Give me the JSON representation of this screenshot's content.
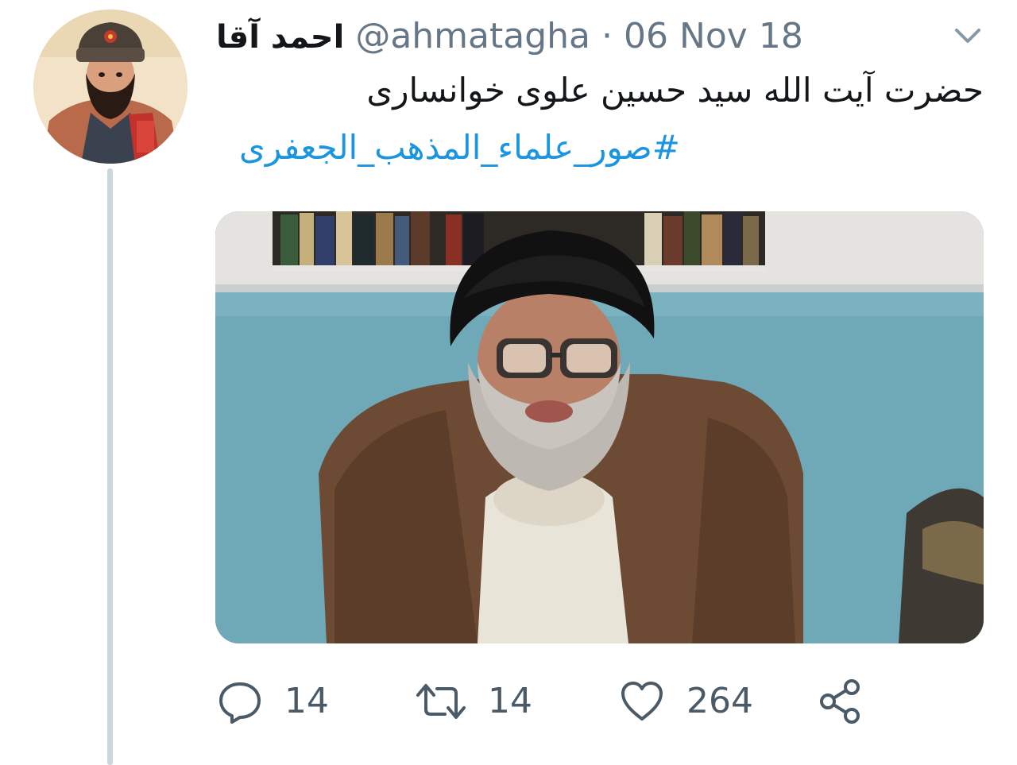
{
  "tweet": {
    "display_name": "احمد آقا",
    "handle": "@ahmatagha",
    "separator": "·",
    "date": "06 Nov 18",
    "text": "حضرت آیت الله سید حسین علوی خوانساری",
    "hashtag": "#صور_علماء_المذهب_الجعفری"
  },
  "actions": {
    "replies": "14",
    "retweets": "14",
    "likes": "264"
  },
  "icons": {
    "menu": "chevron-down-icon",
    "reply": "comment-bubble-icon",
    "retweet": "retweet-arrows-icon",
    "like": "heart-icon",
    "share": "share-nodes-icon"
  },
  "colors": {
    "hashtag": "#1b95e0",
    "secondary_text": "#657786",
    "icon": "#4a5a66",
    "thread_line": "#ccd6dd"
  }
}
